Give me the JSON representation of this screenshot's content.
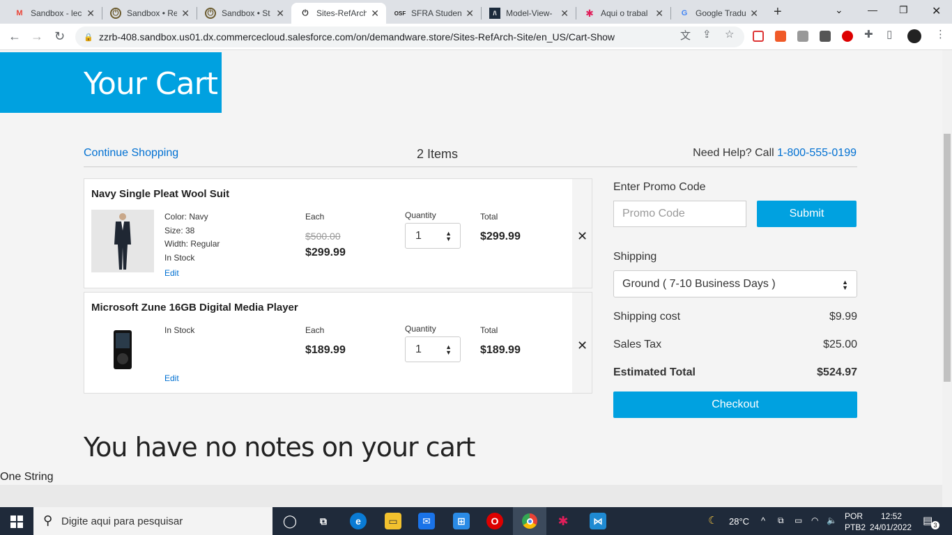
{
  "browser": {
    "tabs": [
      {
        "title": "Sandbox - lec",
        "icon": "gmail-icon",
        "color": "#ea4335"
      },
      {
        "title": "Sandbox • Re",
        "icon": "power-icon",
        "color": "#6b5b2e"
      },
      {
        "title": "Sandbox • St",
        "icon": "power-icon",
        "color": "#6b5b2e"
      },
      {
        "title": "Sites-RefArch",
        "icon": "power-icon",
        "color": "#222222"
      },
      {
        "title": "SFRA Student",
        "icon": "osf-icon",
        "color": "#222222"
      },
      {
        "title": "Model-View-",
        "icon": "code-icon",
        "color": "#1c2b3c"
      },
      {
        "title": "Aqui o trabal",
        "icon": "slack-icon",
        "color": "#e01e5a"
      },
      {
        "title": "Google Tradu",
        "icon": "translate-icon",
        "color": "#4285f4"
      }
    ],
    "url": "zzrb-408.sandbox.us01.dx.commercecloud.salesforce.com/on/demandware.store/Sites-RefArch-Site/en_US/Cart-Show"
  },
  "page": {
    "title": "Your Cart",
    "continue_label": "Continue Shopping",
    "item_count": "2 Items",
    "help_text": "Need Help? Call ",
    "help_phone": "1-800-555-0199",
    "col_each": "Each",
    "col_quantity": "Quantity",
    "col_total": "Total",
    "edit_label": "Edit",
    "products": [
      {
        "name": "Navy Single Pleat Wool Suit",
        "attributes": [
          "Color: Navy",
          "Size: 38",
          "Width: Regular",
          "In Stock"
        ],
        "list_price": "$500.00",
        "price": "$299.99",
        "quantity": "1",
        "total": "$299.99"
      },
      {
        "name": "Microsoft Zune 16GB Digital Media Player",
        "attributes": [
          "In Stock"
        ],
        "price": "$189.99",
        "quantity": "1",
        "total": "$189.99"
      }
    ],
    "promo_label": "Enter Promo Code",
    "promo_placeholder": "Promo Code",
    "submit_label": "Submit",
    "shipping_label": "Shipping",
    "shipping_method": "Ground ( 7-10 Business Days )",
    "shipping_cost_label": "Shipping cost",
    "shipping_cost": "$9.99",
    "sales_tax_label": "Sales Tax",
    "sales_tax": "$25.00",
    "estimated_total_label": "Estimated Total",
    "estimated_total": "$524.97",
    "checkout_label": "Checkout",
    "notes_text": "You have no notes on your cart",
    "footer_text": "One String",
    "accent_color": "#00a1e0",
    "link_color": "#0070d2"
  },
  "taskbar": {
    "search_placeholder": "Digite aqui para pesquisar",
    "temperature": "28°C",
    "language": "POR",
    "layout": "PTB2",
    "time": "12:52",
    "date": "24/01/2022",
    "notifications": "3"
  }
}
